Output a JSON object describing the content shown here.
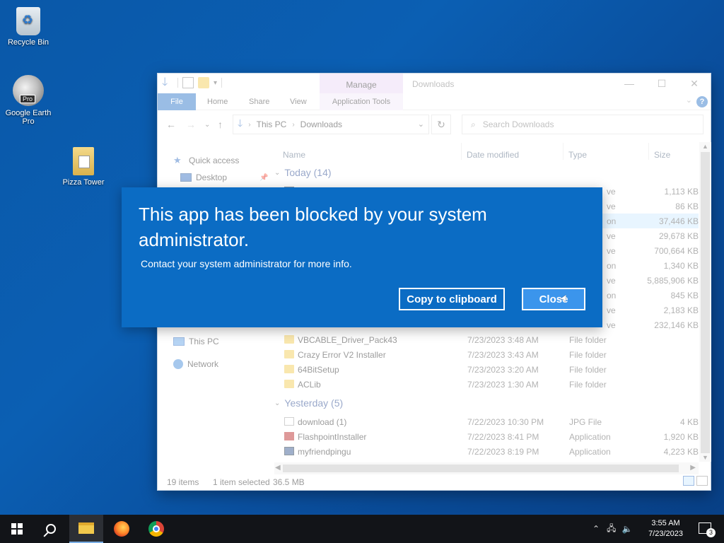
{
  "desktop": {
    "icons": [
      {
        "label": "Recycle Bin"
      },
      {
        "label": "Google Earth Pro",
        "badge": "Pro"
      },
      {
        "label": "Pizza Tower"
      }
    ]
  },
  "explorer": {
    "title": "Downloads",
    "manage_tab": "Manage",
    "ribbon_tabs": [
      "File",
      "Home",
      "Share",
      "View",
      "Application Tools"
    ],
    "breadcrumb": [
      "This PC",
      "Downloads"
    ],
    "search_placeholder": "Search Downloads",
    "nav_pane": {
      "items": [
        "Quick access",
        "Desktop",
        "This PC",
        "Network"
      ]
    },
    "columns": [
      "Name",
      "Date modified",
      "Type",
      "Size"
    ],
    "groups": [
      {
        "label": "Today (14)"
      },
      {
        "label": "Yesterday (5)"
      }
    ],
    "rows_today_partial": [
      {
        "type": "ve",
        "size": "1,113 KB"
      },
      {
        "type": "ve",
        "size": "86 KB"
      },
      {
        "type": "on",
        "size": "37,446 KB",
        "selected": true
      },
      {
        "type": "ve",
        "size": "29,678 KB"
      },
      {
        "type": "ve",
        "size": "700,664 KB"
      },
      {
        "type": "on",
        "size": "1,340 KB"
      },
      {
        "type": "ve",
        "size": "5,885,906 KB"
      },
      {
        "type": "on",
        "size": "845 KB"
      },
      {
        "type": "ve",
        "size": "2,183 KB"
      },
      {
        "type": "ve",
        "size": "232,146 KB"
      }
    ],
    "rows_today": [
      {
        "name": "VBCABLE_Driver_Pack43",
        "date": "7/23/2023 3:48 AM",
        "type": "File folder",
        "size": "",
        "icon": "folder-icon"
      },
      {
        "name": "Crazy Error V2 Installer",
        "date": "7/23/2023 3:43 AM",
        "type": "File folder",
        "size": "",
        "icon": "folder-icon"
      },
      {
        "name": "64BitSetup",
        "date": "7/23/2023 3:20 AM",
        "type": "File folder",
        "size": "",
        "icon": "folder-icon"
      },
      {
        "name": "ACLib",
        "date": "7/23/2023 1:30 AM",
        "type": "File folder",
        "size": "",
        "icon": "folder-icon"
      }
    ],
    "rows_yesterday": [
      {
        "name": "download (1)",
        "date": "7/22/2023 10:30 PM",
        "type": "JPG File",
        "size": "4 KB",
        "icon": "image-file-icon"
      },
      {
        "name": "FlashpointInstaller",
        "date": "7/22/2023 8:41 PM",
        "type": "Application",
        "size": "1,920 KB",
        "icon": "flashpoint-app-icon"
      },
      {
        "name": "myfriendpingu",
        "date": "7/22/2023 8:19 PM",
        "type": "Application",
        "size": "4,223 KB",
        "icon": "installer-app-icon"
      }
    ],
    "status": {
      "items": "19 items",
      "selected": "1 item selected",
      "size": "36.5 MB"
    }
  },
  "dialog": {
    "title": "This app has been blocked by your system administrator.",
    "message": "Contact your system administrator for more info.",
    "copy_button": "Copy to clipboard",
    "close_button": "Close"
  },
  "taskbar": {
    "time": "3:55 AM",
    "date": "7/23/2023",
    "notifications": "3"
  }
}
